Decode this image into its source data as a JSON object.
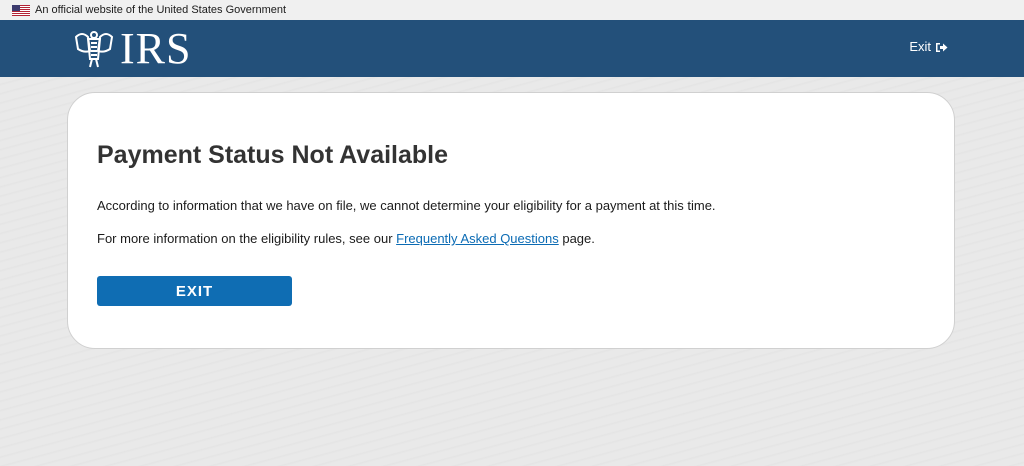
{
  "gov_banner": {
    "text": "An official website of the United States Government",
    "icon": "us-flag-icon"
  },
  "header": {
    "logo_text": "IRS",
    "logo_icon": "irs-eagle-icon",
    "exit_label": "Exit",
    "exit_icon": "exit-arrow-icon",
    "background_color": "#23507a"
  },
  "card": {
    "title": "Payment Status Not Available",
    "paragraph1": "According to information that we have on file, we cannot determine your eligibility for a payment at this time.",
    "paragraph2_prefix": "For more information on the eligibility rules, see our ",
    "paragraph2_link": "Frequently Asked Questions",
    "paragraph2_suffix": " page.",
    "button_label": "EXIT",
    "button_color": "#0f6db3",
    "link_color": "#0b6bb4"
  }
}
